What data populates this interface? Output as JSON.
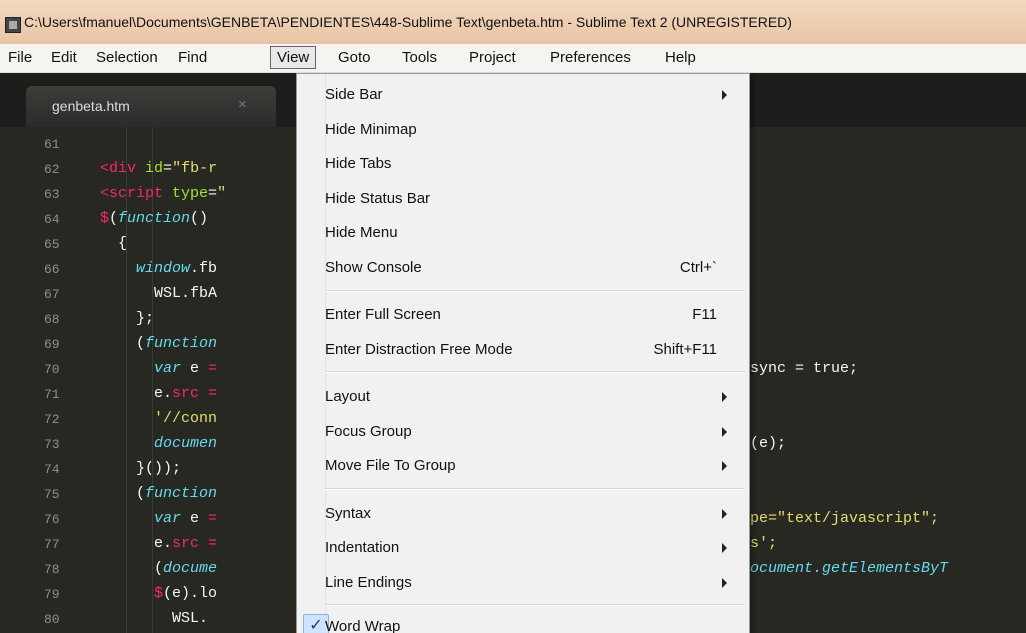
{
  "window": {
    "title": "C:\\Users\\fmanuel\\Documents\\GENBETA\\PENDIENTES\\448-Sublime Text\\genbeta.htm - Sublime Text 2 (UNREGISTERED)"
  },
  "menubar": {
    "items": [
      "File",
      "Edit",
      "Selection",
      "Find",
      "View",
      "Goto",
      "Tools",
      "Project",
      "Preferences",
      "Help"
    ],
    "active": "View"
  },
  "tab": {
    "label": "genbeta.htm",
    "close": "×"
  },
  "gutter": {
    "lines": [
      "61",
      "62",
      "63",
      "64",
      "65",
      "66",
      "67",
      "68",
      "69",
      "70",
      "71",
      "72",
      "73",
      "74",
      "75",
      "76",
      "77",
      "78",
      "79",
      "80"
    ]
  },
  "code_right": {
    "l70": "sync = true;",
    "l73": "(e);",
    "l76": "pe=\"text/javascript\";",
    "l77": "s';",
    "l78": "ocument.getElementsByT"
  },
  "view_menu": {
    "items": [
      {
        "label": "Side Bar",
        "submenu": true
      },
      {
        "label": "Hide Minimap"
      },
      {
        "label": "Hide Tabs"
      },
      {
        "label": "Hide Status Bar"
      },
      {
        "label": "Hide Menu"
      },
      {
        "label": "Show Console",
        "shortcut": "Ctrl+`"
      },
      {
        "label": "Enter Full Screen",
        "shortcut": "F11"
      },
      {
        "label": "Enter Distraction Free Mode",
        "shortcut": "Shift+F11"
      },
      {
        "label": "Layout",
        "submenu": true
      },
      {
        "label": "Focus Group",
        "submenu": true
      },
      {
        "label": "Move File To Group",
        "submenu": true
      },
      {
        "label": "Syntax",
        "submenu": true
      },
      {
        "label": "Indentation",
        "submenu": true
      },
      {
        "label": "Line Endings",
        "submenu": true
      },
      {
        "label": "Word Wrap",
        "checked": true
      }
    ]
  },
  "colors": {
    "editor_bg": "#272822",
    "keyword": "#f92672",
    "string": "#e6db74",
    "italic_fn": "#66d9ef"
  }
}
